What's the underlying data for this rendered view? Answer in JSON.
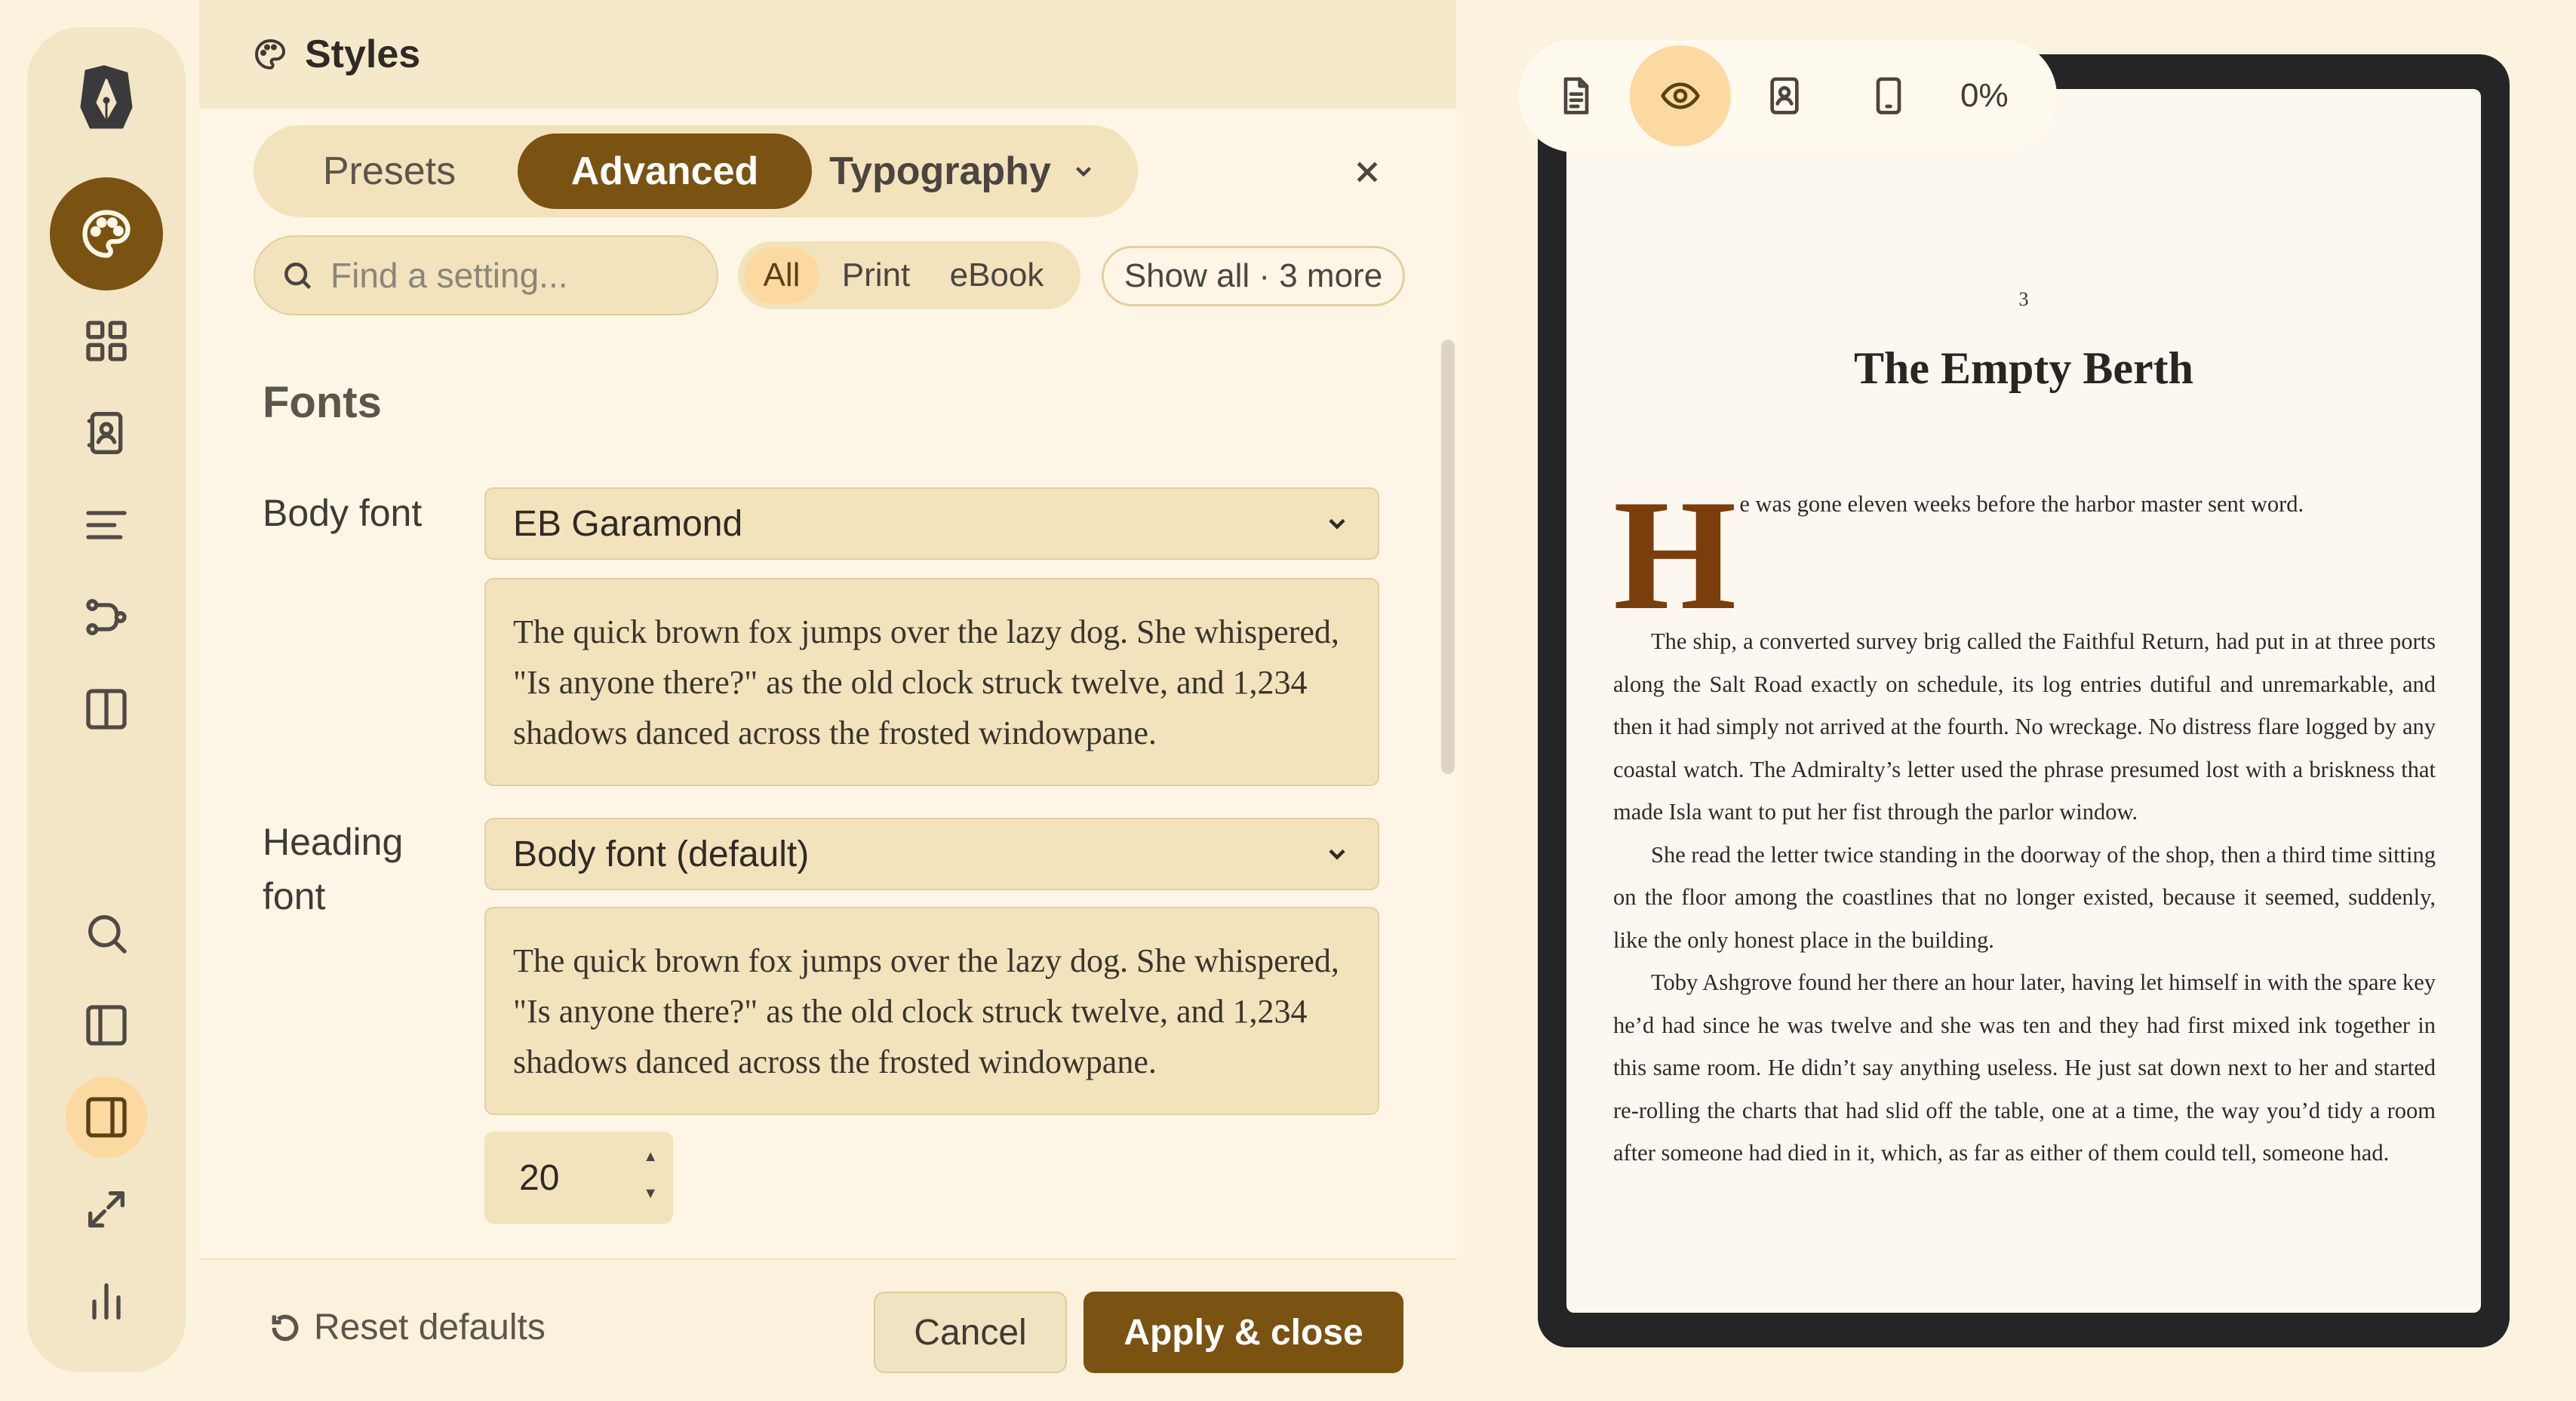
{
  "panel": {
    "title": "Styles",
    "tabs": {
      "presets": "Presets",
      "advanced": "Advanced",
      "typography": "Typography"
    },
    "search_placeholder": "Find a setting...",
    "filters": {
      "all": "All",
      "print": "Print",
      "ebook": "eBook"
    },
    "show_all": "Show all · 3 more",
    "section": "Fonts",
    "body_font": {
      "label": "Body font",
      "value": "EB Garamond",
      "sample": "The quick brown fox jumps over the lazy dog. She whispered, \"Is anyone there?\" as the old clock struck twelve, and 1,234 shadows danced across the frosted windowpane."
    },
    "heading_font": {
      "label": "Heading font",
      "value": "Body font (default)",
      "sample": "The quick brown fox jumps over the lazy dog. She whispered, \"Is anyone there?\" as the old clock struck twelve, and 1,234 shadows danced across the frosted windowpane."
    },
    "size_value": "20",
    "footer": {
      "reset": "Reset defaults",
      "cancel": "Cancel",
      "apply": "Apply & close"
    }
  },
  "rail": {
    "icons": [
      "logo-icon",
      "palette-icon",
      "grid-icon",
      "contact-book-icon",
      "align-left-icon",
      "flow-icon",
      "columns-icon",
      "search-icon",
      "sidebar-left-icon",
      "sidebar-right-icon",
      "expand-icon",
      "stats-icon"
    ],
    "active": "palette-icon"
  },
  "preview": {
    "toolbar": {
      "zoom": "0%",
      "active_tool": "eye-icon"
    },
    "page_number": "3",
    "chapter_title": "The Empty Berth",
    "drop_cap": "H",
    "first_line": "e was gone eleven weeks before the harbor master sent word.",
    "paragraphs": [
      "The ship, a converted survey brig called the Faithful Return, had put in at three ports along the Salt Road exactly on schedule, its log entries dutiful and unremarkable, and then it had simply not arrived at the fourth. No wreckage. No distress flare logged by any coastal watch. The Admiralty’s letter used the phrase presumed lost with a brisk­ness that made Isla want to put her fist through the parlor window.",
      "She read the letter twice standing in the doorway of the shop, then a third time sit­ting on the floor among the coastlines that no longer existed, because it seemed, sud­denly, like the only honest place in the building.",
      "Toby Ashgrove found her there an hour later, having let himself in with the spare key he’d had since he was twelve and she was ten and they had first mixed ink together in this same room. He didn’t say anything useless. He just sat down next to her and started re-rolling the charts that had slid off the table, one at a time, the way you’d tidy a room after someone had died in it, which, as far as either of them could tell, someone had."
    ]
  },
  "colors": {
    "accent": "#7a5212",
    "accent_light": "#fbd9a0",
    "drop_cap": "#7a3d0c",
    "device": "#252527"
  }
}
